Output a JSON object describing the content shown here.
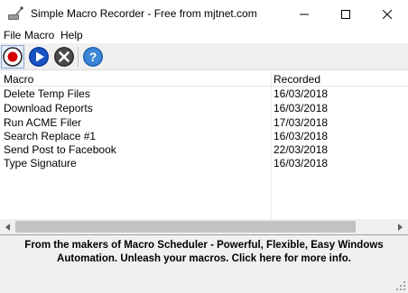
{
  "window": {
    "title": "Simple Macro Recorder - Free from mjtnet.com"
  },
  "menu": {
    "file": "File",
    "macro": "Macro",
    "help": "Help"
  },
  "toolbar": {
    "record_icon": "record-icon",
    "play_icon": "play-icon",
    "stop_icon": "stop-icon",
    "help_icon": "help-icon"
  },
  "list": {
    "columns": {
      "macro": "Macro",
      "recorded": "Recorded"
    },
    "rows": [
      {
        "name": "Delete Temp Files",
        "recorded": "16/03/2018"
      },
      {
        "name": "Download Reports",
        "recorded": "16/03/2018"
      },
      {
        "name": "Run ACME Filer",
        "recorded": "17/03/2018"
      },
      {
        "name": "Search Replace #1",
        "recorded": "16/03/2018"
      },
      {
        "name": "Send Post to Facebook",
        "recorded": "22/03/2018"
      },
      {
        "name": "Type Signature",
        "recorded": "16/03/2018"
      }
    ]
  },
  "banner": {
    "text": "From the makers of Macro Scheduler - Powerful, Flexible, Easy Windows Automation. Unleash your macros. Click here for more info."
  },
  "colors": {
    "record": "#d40000",
    "play": "#0a3a9c",
    "stop": "#3a3a3a",
    "help": "#2a73c4"
  }
}
